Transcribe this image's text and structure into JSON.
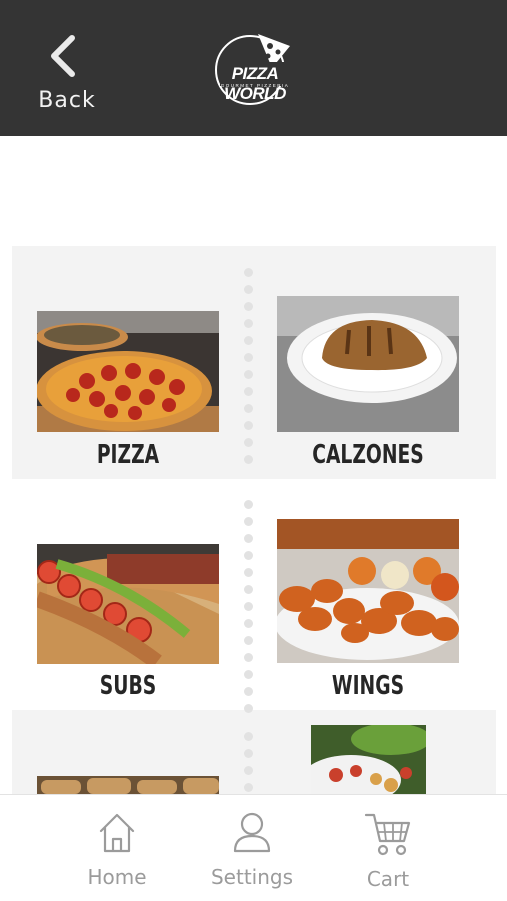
{
  "header": {
    "back_label": "Back",
    "logo_text": "PIZZA WORLD",
    "logo_subtext": "GOURMET PIZZERIA",
    "background": "#343434"
  },
  "categories": [
    {
      "label": "PIZZA",
      "image": "pizza-photo"
    },
    {
      "label": "CALZONES",
      "image": "calzone-photo"
    },
    {
      "label": "SUBS",
      "image": "sub-sandwich-photo"
    },
    {
      "label": "WINGS",
      "image": "wings-photo"
    },
    {
      "label": "",
      "image": "rolls-photo"
    },
    {
      "label": "",
      "image": "salad-photo"
    }
  ],
  "tabbar": {
    "items": [
      {
        "label": "Home",
        "icon": "home-icon"
      },
      {
        "label": "Settings",
        "icon": "user-icon"
      },
      {
        "label": "Cart",
        "icon": "cart-icon"
      }
    ],
    "icon_color": "#9b9b9b"
  }
}
